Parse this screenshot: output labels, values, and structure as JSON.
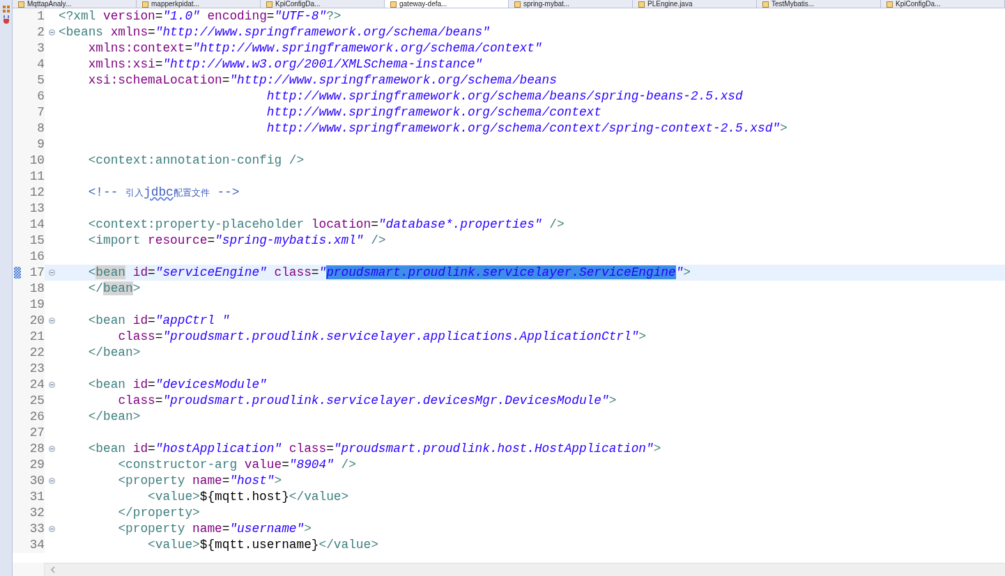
{
  "tabs": [
    {
      "label": "MqttapAnaly...",
      "selected": false
    },
    {
      "label": "mapperkpidat...",
      "selected": false
    },
    {
      "label": "KpiConfigDa...",
      "selected": false
    },
    {
      "label": "gateway-defa...",
      "selected": true
    },
    {
      "label": "spring-mybat...",
      "selected": false
    },
    {
      "label": "PLEngine.java",
      "selected": false
    },
    {
      "label": "TestMybatis...",
      "selected": false
    },
    {
      "label": "KpiConfigDa...",
      "selected": false
    }
  ],
  "editor": {
    "lines": [
      {
        "number": "1",
        "fold": false,
        "current": false,
        "marker": false,
        "text": "<?xml version=\"1.0\" encoding=\"UTF-8\"?>"
      },
      {
        "number": "2",
        "fold": true,
        "current": false,
        "marker": false,
        "text": "<beans xmlns=\"http://www.springframework.org/schema/beans\""
      },
      {
        "number": "3",
        "fold": false,
        "current": false,
        "marker": false,
        "text": "    xmlns:context=\"http://www.springframework.org/schema/context\""
      },
      {
        "number": "4",
        "fold": false,
        "current": false,
        "marker": false,
        "text": "    xmlns:xsi=\"http://www.w3.org/2001/XMLSchema-instance\""
      },
      {
        "number": "5",
        "fold": false,
        "current": false,
        "marker": false,
        "text": "    xsi:schemaLocation=\"http://www.springframework.org/schema/beans"
      },
      {
        "number": "6",
        "fold": false,
        "current": false,
        "marker": false,
        "text": "                            http://www.springframework.org/schema/beans/spring-beans-2.5.xsd"
      },
      {
        "number": "7",
        "fold": false,
        "current": false,
        "marker": false,
        "text": "                            http://www.springframework.org/schema/context"
      },
      {
        "number": "8",
        "fold": false,
        "current": false,
        "marker": false,
        "text": "                            http://www.springframework.org/schema/context/spring-context-2.5.xsd\">"
      },
      {
        "number": "9",
        "fold": false,
        "current": false,
        "marker": false
      },
      {
        "number": "10",
        "fold": false,
        "current": false,
        "marker": false,
        "text": "    <context:annotation-config />"
      },
      {
        "number": "11",
        "fold": false,
        "current": false,
        "marker": false
      },
      {
        "number": "12",
        "fold": false,
        "current": false,
        "marker": false,
        "segments": [
          {
            "text": "    <!-- 引入",
            "selected": false,
            "occurrence": false,
            "misspelled": false
          },
          {
            "text": "jdbc",
            "selected": false,
            "occurrence": false,
            "misspelled": true
          },
          {
            "text": "配置文件 -->",
            "selected": false,
            "occurrence": false,
            "misspelled": false
          }
        ]
      },
      {
        "number": "13",
        "fold": false,
        "current": false,
        "marker": false
      },
      {
        "number": "14",
        "fold": false,
        "current": false,
        "marker": false,
        "text": "    <context:property-placeholder location=\"database*.properties\" />"
      },
      {
        "number": "15",
        "fold": false,
        "current": false,
        "marker": false,
        "text": "    <import resource=\"spring-mybatis.xml\" />"
      },
      {
        "number": "16",
        "fold": false,
        "current": false,
        "marker": false
      },
      {
        "number": "17",
        "fold": true,
        "current": true,
        "marker": true,
        "segments": [
          {
            "text": "    <",
            "selected": false,
            "occurrence": false,
            "misspelled": false
          },
          {
            "text": "bean",
            "selected": false,
            "occurrence": true,
            "misspelled": false
          },
          {
            "text": " id=\"serviceEngine\" class=\"",
            "selected": false,
            "occurrence": false,
            "misspelled": false
          },
          {
            "text": "proudsmart.proudlink.servicelayer.ServiceEngine",
            "selected": true,
            "occurrence": false,
            "misspelled": false
          },
          {
            "text": "\">",
            "selected": false,
            "occurrence": false,
            "misspelled": false
          }
        ]
      },
      {
        "number": "18",
        "fold": false,
        "current": false,
        "marker": false,
        "segments": [
          {
            "text": "    </",
            "selected": false,
            "occurrence": false,
            "misspelled": false
          },
          {
            "text": "bean",
            "selected": false,
            "occurrence": true,
            "misspelled": false
          },
          {
            "text": ">",
            "selected": false,
            "occurrence": false,
            "misspelled": false
          }
        ]
      },
      {
        "number": "19",
        "fold": false,
        "current": false,
        "marker": false
      },
      {
        "number": "20",
        "fold": true,
        "current": false,
        "marker": false,
        "text": "    <bean id=\"appCtrl \""
      },
      {
        "number": "21",
        "fold": false,
        "current": false,
        "marker": false,
        "text": "        class=\"proudsmart.proudlink.servicelayer.applications.ApplicationCtrl\">"
      },
      {
        "number": "22",
        "fold": false,
        "current": false,
        "marker": false,
        "text": "    </bean>"
      },
      {
        "number": "23",
        "fold": false,
        "current": false,
        "marker": false
      },
      {
        "number": "24",
        "fold": true,
        "current": false,
        "marker": false,
        "text": "    <bean id=\"devicesModule\""
      },
      {
        "number": "25",
        "fold": false,
        "current": false,
        "marker": false,
        "text": "        class=\"proudsmart.proudlink.servicelayer.devicesMgr.DevicesModule\">"
      },
      {
        "number": "26",
        "fold": false,
        "current": false,
        "marker": false,
        "text": "    </bean>"
      },
      {
        "number": "27",
        "fold": false,
        "current": false,
        "marker": false
      },
      {
        "number": "28",
        "fold": true,
        "current": false,
        "marker": false,
        "text": "    <bean id=\"hostApplication\" class=\"proudsmart.proudlink.host.HostApplication\">"
      },
      {
        "number": "29",
        "fold": false,
        "current": false,
        "marker": false,
        "text": "        <constructor-arg value=\"8904\" />"
      },
      {
        "number": "30",
        "fold": true,
        "current": false,
        "marker": false,
        "text": "        <property name=\"host\">"
      },
      {
        "number": "31",
        "fold": false,
        "current": false,
        "marker": false,
        "text": "            <value>${mqtt.host}</value>"
      },
      {
        "number": "32",
        "fold": false,
        "current": false,
        "marker": false,
        "text": "        </property>"
      },
      {
        "number": "33",
        "fold": true,
        "current": false,
        "marker": false,
        "text": "        <property name=\"username\">"
      },
      {
        "number": "34",
        "fold": false,
        "current": false,
        "marker": false,
        "text": "            <value>${mqtt.username}</value>"
      }
    ]
  }
}
